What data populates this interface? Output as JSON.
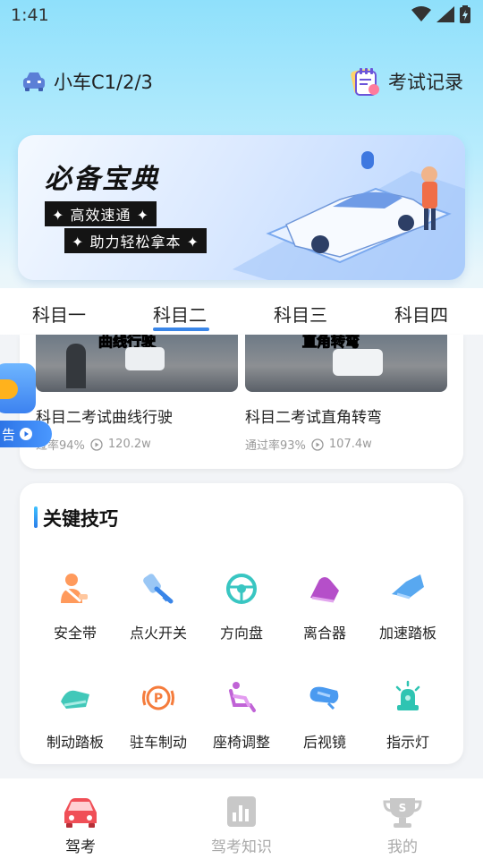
{
  "status_bar": {
    "time": "1:41"
  },
  "header": {
    "car_type": "小车C1/2/3",
    "exam_record": "考试记录"
  },
  "banner": {
    "title": "必备宝典",
    "tag1": "✦ 高效速通 ✦",
    "tag2": "✦ 助力轻松拿本 ✦"
  },
  "tabs": [
    "科目一",
    "科目二",
    "科目三",
    "科目四"
  ],
  "active_tab": "科目二",
  "videos": [
    {
      "title": "科目二考试曲线行驶",
      "pass_rate": "过率94%",
      "views": "120.2w",
      "thumb_text": "曲线行驶"
    },
    {
      "title": "科目二考试直角转弯",
      "pass_rate": "通过率93%",
      "views": "107.4w",
      "thumb_text": "直角转弯"
    }
  ],
  "ad": {
    "label": "告"
  },
  "skills": {
    "title": "关键技巧",
    "items": [
      {
        "label": "安全带",
        "icon": "seatbelt-icon"
      },
      {
        "label": "点火开关",
        "icon": "ignition-key-icon"
      },
      {
        "label": "方向盘",
        "icon": "steering-wheel-icon"
      },
      {
        "label": "离合器",
        "icon": "clutch-pedal-icon"
      },
      {
        "label": "加速踏板",
        "icon": "accelerator-pedal-icon"
      },
      {
        "label": "制动踏板",
        "icon": "brake-pedal-icon"
      },
      {
        "label": "驻车制动",
        "icon": "parking-brake-icon"
      },
      {
        "label": "座椅调整",
        "icon": "seat-adjust-icon"
      },
      {
        "label": "后视镜",
        "icon": "rearview-mirror-icon"
      },
      {
        "label": "指示灯",
        "icon": "indicator-light-icon"
      }
    ]
  },
  "bottom_nav": [
    {
      "label": "驾考",
      "active": true,
      "icon": "car-icon"
    },
    {
      "label": "驾考知识",
      "active": false,
      "icon": "knowledge-chart-icon"
    },
    {
      "label": "我的",
      "active": false,
      "icon": "trophy-icon"
    }
  ],
  "colors": {
    "accent": "#3a86e8",
    "active_nav": "#222222",
    "inactive_nav": "#aaaaaa"
  }
}
